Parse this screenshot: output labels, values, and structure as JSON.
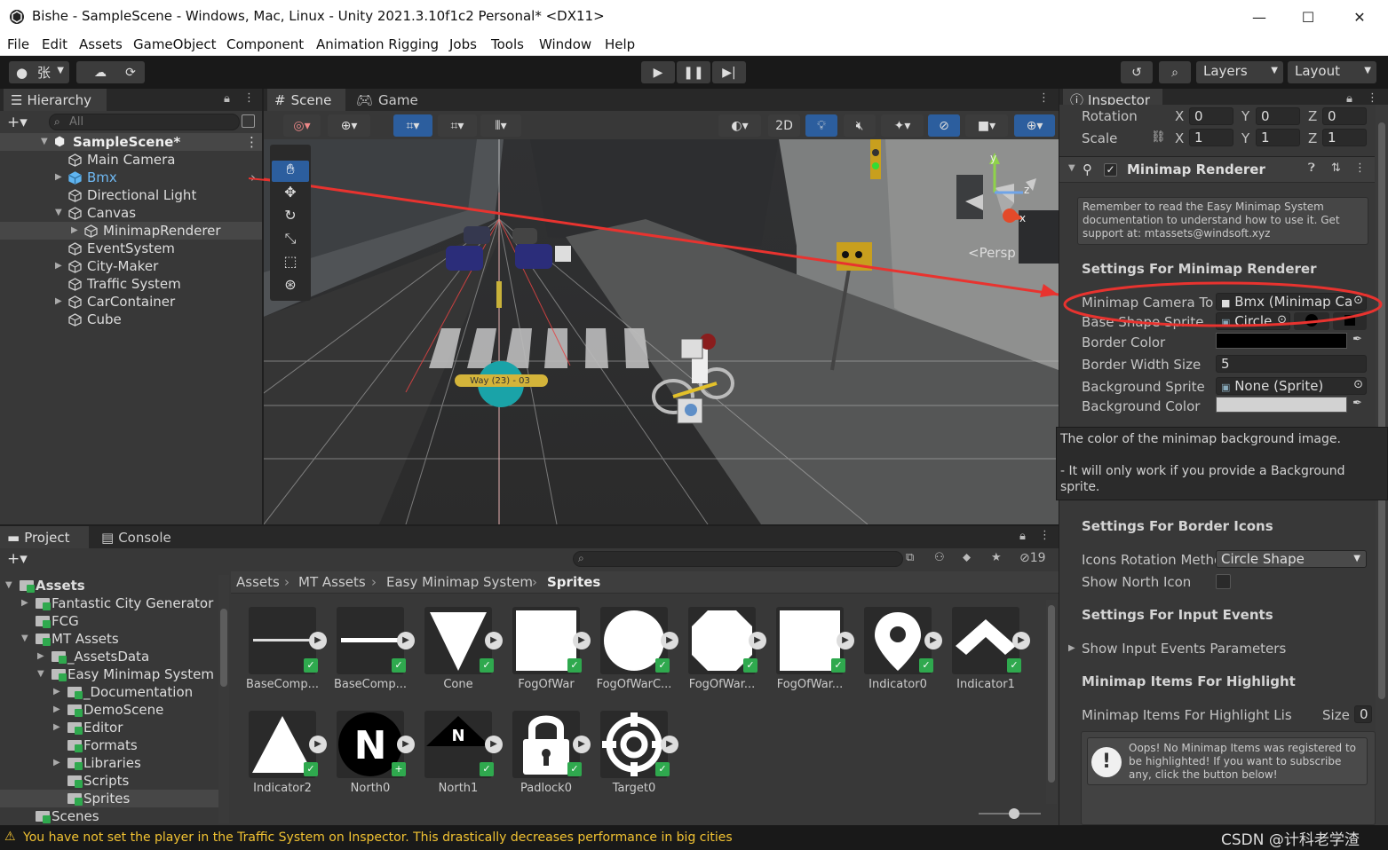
{
  "window": {
    "title": "Bishe - SampleScene - Windows, Mac, Linux - Unity 2021.3.10f1c2 Personal* <DX11>",
    "min": "—",
    "max": "☐",
    "close": "✕"
  },
  "menu": [
    "File",
    "Edit",
    "Assets",
    "GameObject",
    "Component",
    "Animation Rigging",
    "Jobs",
    "Tools",
    "Window",
    "Help"
  ],
  "toolbar": {
    "account": "张",
    "layers": "Layers",
    "layout": "Layout"
  },
  "hierarchy": {
    "tab": "Hierarchy",
    "search_placeholder": "All",
    "scene": "SampleScene*",
    "items": [
      {
        "label": "Main Camera"
      },
      {
        "label": "Bmx"
      },
      {
        "label": "Directional Light"
      },
      {
        "label": "Canvas"
      },
      {
        "label": "MinimapRenderer"
      },
      {
        "label": "EventSystem"
      },
      {
        "label": "City-Maker"
      },
      {
        "label": "Traffic System"
      },
      {
        "label": "CarContainer"
      },
      {
        "label": "Cube"
      }
    ]
  },
  "scene": {
    "tabs": [
      "Scene",
      "Game"
    ],
    "mode_2d": "2D",
    "persp": "<Persp",
    "waypoint": "Way (23) - 03",
    "gizmo_axes": {
      "y": "y",
      "z": "z",
      "x": "x"
    }
  },
  "inspector": {
    "tab": "Inspector",
    "rotation": {
      "label": "Rotation",
      "x": "0",
      "y": "0",
      "z": "0"
    },
    "scale": {
      "label": "Scale",
      "x": "1",
      "y": "1",
      "z": "1"
    },
    "axis": {
      "x": "X",
      "y": "Y",
      "z": "Z"
    },
    "component": "Minimap Renderer",
    "helpbox": "Remember to read the Easy Minimap System documentation to understand how to use it. Get support at: mtassets@windsoft.xyz",
    "section_renderer": "Settings For Minimap Renderer",
    "fields": {
      "minimap_camera": {
        "label": "Minimap Camera To",
        "value": "Bmx (Minimap Ca"
      },
      "base_shape": {
        "label": "Base Shape Sprite",
        "value": "Circle"
      },
      "border_color": {
        "label": "Border Color"
      },
      "border_width": {
        "label": "Border Width Size",
        "value": "5"
      },
      "background_sprite": {
        "label": "Background Sprite",
        "value": "None (Sprite)"
      },
      "background_color": {
        "label": "Background Color"
      }
    },
    "tooltip_line1": "The color of the minimap background image.",
    "tooltip_line2": "- It will only work if you provide a Background sprite.",
    "section_border_icons": "Settings For Border Icons",
    "icons_rotation": {
      "label": "Icons Rotation Methc",
      "value": "Circle Shape"
    },
    "show_north_icon": "Show North Icon",
    "section_input_events": "Settings For Input Events",
    "show_input_events": "Show Input Events Parameters",
    "section_highlight": "Minimap Items For Highlight",
    "highlight_list": {
      "label": "Minimap Items For Highlight Lis",
      "size_label": "Size",
      "size_value": "0"
    },
    "warning": "Oops! No Minimap Items was registered to be highlighted! If you want to subscribe any, click the button below!"
  },
  "project": {
    "tabs": [
      "Project",
      "Console"
    ],
    "asset_count": "19",
    "tree": [
      {
        "label": "Assets"
      },
      {
        "label": "Fantastic City Generator"
      },
      {
        "label": "FCG"
      },
      {
        "label": "MT Assets"
      },
      {
        "label": "_AssetsData"
      },
      {
        "label": "Easy Minimap System"
      },
      {
        "label": "_Documentation"
      },
      {
        "label": "DemoScene"
      },
      {
        "label": "Editor"
      },
      {
        "label": "Formats"
      },
      {
        "label": "Libraries"
      },
      {
        "label": "Scripts"
      },
      {
        "label": "Sprites"
      },
      {
        "label": "Scenes"
      }
    ],
    "breadcrumb": [
      "Assets",
      "MT Assets",
      "Easy Minimap System",
      "Sprites"
    ],
    "assets": [
      {
        "name": "BaseComp..."
      },
      {
        "name": "BaseComp..."
      },
      {
        "name": "Cone"
      },
      {
        "name": "FogOfWar"
      },
      {
        "name": "FogOfWarC..."
      },
      {
        "name": "FogOfWar..."
      },
      {
        "name": "FogOfWar..."
      },
      {
        "name": "Indicator0"
      },
      {
        "name": "Indicator1"
      },
      {
        "name": "Indicator2"
      },
      {
        "name": "North0"
      },
      {
        "name": "North1"
      },
      {
        "name": "Padlock0"
      },
      {
        "name": "Target0"
      }
    ]
  },
  "status": {
    "message": "You have not set the player in the Traffic System on Inspector. This drastically decreases performance in big cities",
    "watermark": "CSDN @计科老学渣"
  },
  "colors": {
    "accent_red": "#e8332f",
    "selected_blue": "#2c5e9e",
    "warning_yellow": "#f1c232"
  }
}
